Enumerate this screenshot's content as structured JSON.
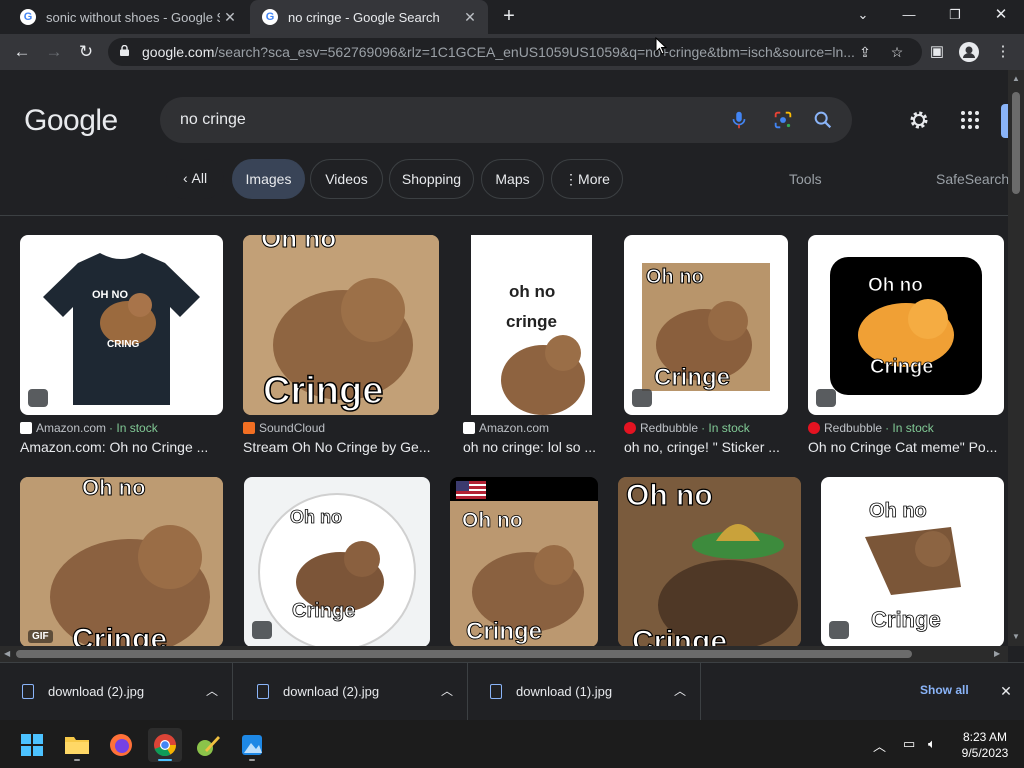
{
  "browser": {
    "tabs": [
      {
        "title": "sonic without shoes - Google Search",
        "active": false
      },
      {
        "title": "no cringe - Google Search",
        "active": true
      }
    ],
    "url_host": "google.com",
    "url_rest": "/search?sca_esv=562769096&rlz=1C1GCEA_enUS1059US1059&q=no+cringe&tbm=isch&source=ln..."
  },
  "google": {
    "logo": "Google",
    "query": "no cringe",
    "chips": {
      "all": "All",
      "images": "Images",
      "videos": "Videos",
      "shopping": "Shopping",
      "maps": "Maps",
      "more": "More"
    },
    "tools": "Tools",
    "safesearch": "SafeSearch"
  },
  "results_row1": [
    {
      "source": "Amazon.com",
      "stock": "In stock",
      "caption": "Amazon.com: Oh no Cringe ...",
      "thumb_text_top": "OH NO",
      "thumb_text_bottom": "CRING",
      "source_icon": "amazon"
    },
    {
      "source": "SoundCloud",
      "stock": "",
      "caption": "Stream Oh No Cringe by Ge...",
      "thumb_text_top": "Oh no",
      "thumb_text_bottom": "Cringe",
      "source_icon": "soundcloud"
    },
    {
      "source": "Amazon.com",
      "stock": "",
      "caption": "oh no cringe: lol so ...",
      "thumb_text_top": "oh no",
      "thumb_text_mid": "cringe",
      "source_icon": "amazon"
    },
    {
      "source": "Redbubble",
      "stock": "In stock",
      "caption": "oh no, cringe! \" Sticker ...",
      "thumb_text_top": "Oh no",
      "thumb_text_bottom": "Cringe",
      "source_icon": "redbubble"
    },
    {
      "source": "Redbubble",
      "stock": "In stock",
      "caption": "Oh no Cringe Cat meme\" Po...",
      "thumb_text_top": "Oh no",
      "thumb_text_bottom": "Cringe",
      "source_icon": "redbubble"
    }
  ],
  "results_row2": [
    {
      "thumb_text_top": "Oh no",
      "thumb_text_bottom": "Cringe",
      "badge": "GIF"
    },
    {
      "thumb_text_top": "Oh no",
      "thumb_text_bottom": "Cringe"
    },
    {
      "thumb_text_top": "Oh no",
      "thumb_text_bottom": "Cringe"
    },
    {
      "thumb_text_top": "Oh no",
      "thumb_text_bottom": "Cringe"
    },
    {
      "thumb_text_top": "Oh no",
      "thumb_text_bottom": "Cringe"
    }
  ],
  "downloads": [
    {
      "name": "download (2).jpg"
    },
    {
      "name": "download (2).jpg"
    },
    {
      "name": "download (1).jpg"
    }
  ],
  "show_all": "Show all",
  "clock": {
    "time": "8:23 AM",
    "date": "9/5/2023"
  },
  "colors": {
    "accent": "#8ab4f8",
    "in_stock": "#81c995",
    "selected_chip": "#394457"
  }
}
